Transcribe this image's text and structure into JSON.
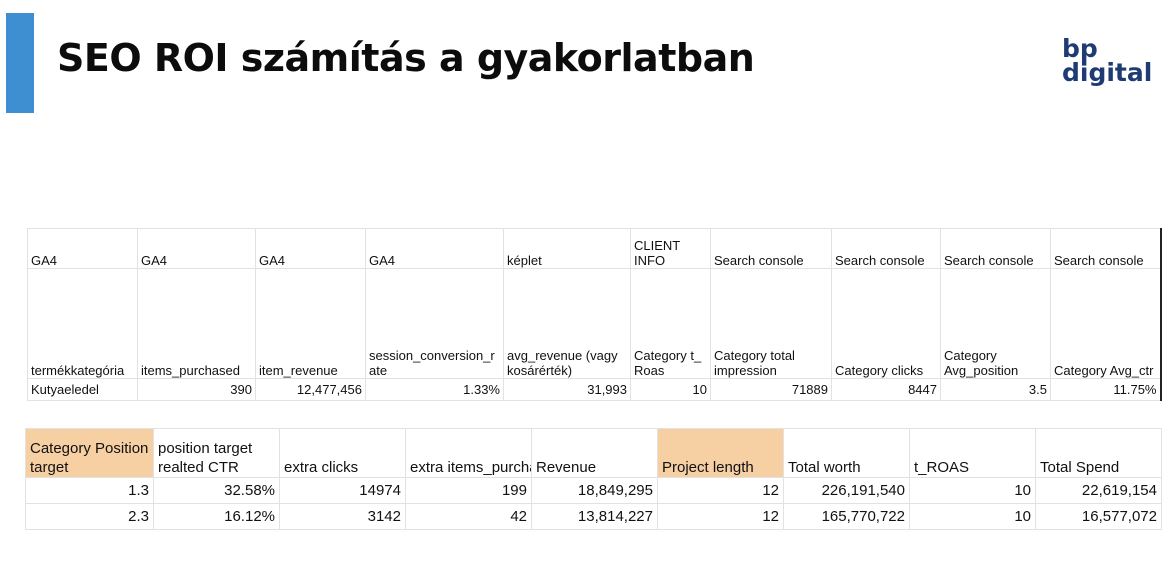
{
  "title": "SEO ROI számítás a gyakorlatban",
  "logo": {
    "line1": "bp",
    "line2": "digital"
  },
  "colors": {
    "accent": "#3d8fd1",
    "highlight": "#f6cfa3",
    "logo": "#1f3b73"
  },
  "table1": {
    "sources": [
      "GA4",
      "GA4",
      "GA4",
      "GA4",
      "képlet",
      "CLIENT INFO",
      "Search console",
      "Search console",
      "Search console",
      "Search console"
    ],
    "headers": [
      "termékkategória",
      "items_purchased",
      "item_revenue",
      "session_conversion_rate",
      "avg_revenue (vagy kosárérték)",
      "Category t_Roas",
      "Category total impression",
      "Category clicks",
      "Category Avg_position",
      "Category Avg_ctr"
    ],
    "rows": [
      [
        "Kutyaeledel",
        "390",
        "12,477,456",
        "1.33%",
        "31,993",
        "10",
        "71889",
        "8447",
        "3.5",
        "11.75%"
      ]
    ]
  },
  "table2": {
    "headers": [
      "Category Position target",
      "position target realted CTR",
      "extra clicks",
      "extra items_purchas",
      "Revenue",
      "Project length",
      "Total worth",
      "t_ROAS",
      "Total Spend"
    ],
    "rows": [
      [
        "1.3",
        "32.58%",
        "14974",
        "199",
        "18,849,295",
        "12",
        "226,191,540",
        "10",
        "22,619,154"
      ],
      [
        "2.3",
        "16.12%",
        "3142",
        "42",
        "13,814,227",
        "12",
        "165,770,722",
        "10",
        "16,577,072"
      ]
    ]
  }
}
